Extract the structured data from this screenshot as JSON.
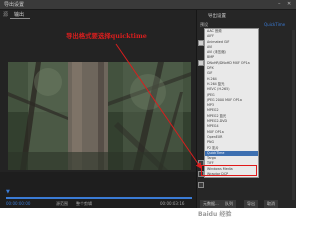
{
  "window": {
    "title": "导出设置"
  },
  "tabs": [
    {
      "label": "源"
    },
    {
      "label": "输出"
    }
  ],
  "annotation": {
    "text": "导出格式要选择quicktime"
  },
  "panel": {
    "section_title": "导出设置",
    "format_value": "QuickTime",
    "preset_label": "预设"
  },
  "format_list": {
    "items": [
      "AAC 音频",
      "AIFF",
      "Animated GIF",
      "AVI",
      "AVI (未压缩)",
      "BMP",
      "DNxHR/DNxHD MXF OP1a",
      "DPX",
      "GIF",
      "H.264",
      "H.264 蓝光",
      "HEVC (H.265)",
      "JPEG",
      "JPEG 2000 MXF OP1a",
      "MP3",
      "MPEG2",
      "MPEG2 蓝光",
      "MPEG2-DVD",
      "MPEG4",
      "MXF OP1a",
      "OpenEXR",
      "PNG",
      "P2 影片",
      "QuickTime",
      "Targa",
      "TIFF",
      "Windows Media",
      "Wraptor DCP",
      "波形音频"
    ],
    "selected": "QuickTime"
  },
  "bottom": {
    "source_range_label": "源范围",
    "source_range_value": "整个剪辑",
    "timecode_start": "00:00:00:00",
    "timecode_end": "00:00:03:16"
  },
  "buttons": {
    "metadata": "元数据...",
    "queue": "队列",
    "export": "导出",
    "cancel": "取消"
  },
  "watermark": {
    "text": "Baidu 经验"
  },
  "colors": {
    "annotation_red": "#d81e1e",
    "selection_blue": "#3d6fb0",
    "accent_blue": "#3a7bd5"
  }
}
